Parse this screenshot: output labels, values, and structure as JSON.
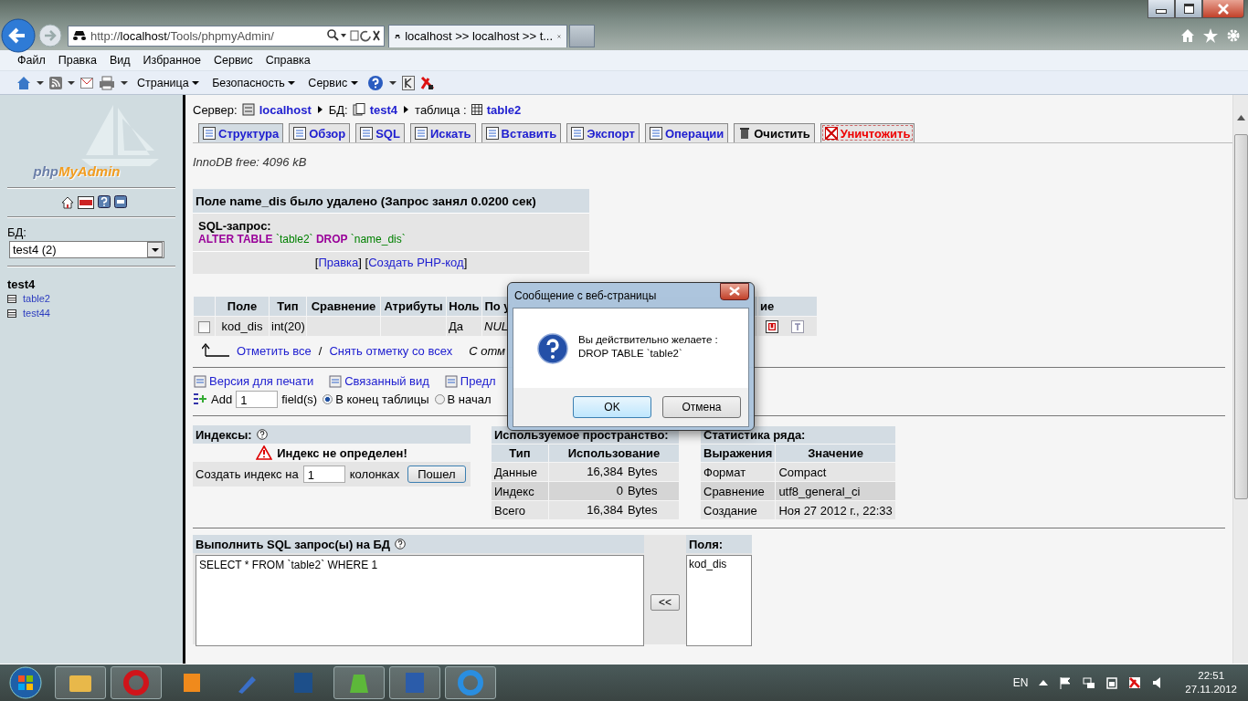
{
  "browser": {
    "address_prefix": "http://",
    "address_host": "localhost",
    "address_path": "/Tools/phpmyAdmin/",
    "tab_title": "localhost >> localhost >> t...",
    "menu": [
      "Файл",
      "Правка",
      "Вид",
      "Избранное",
      "Сервис",
      "Справка"
    ],
    "commands": [
      "Страница",
      "Безопасность",
      "Сервис"
    ]
  },
  "sidebar": {
    "logo_a": "php",
    "logo_b": "MyAdmin",
    "db_label": "БД:",
    "db_select": "test4 (2)",
    "db_name": "test4",
    "tables": [
      "table2",
      "test44"
    ]
  },
  "breadcrumb": {
    "server_label": "Сервер:",
    "server": "localhost",
    "db_label": "БД:",
    "db": "test4",
    "table_label": "таблица :",
    "table": "table2"
  },
  "tabs": [
    {
      "label": "Структура",
      "selected": true,
      "kind": "normal"
    },
    {
      "label": "Обзор",
      "selected": false,
      "kind": "normal"
    },
    {
      "label": "SQL",
      "selected": false,
      "kind": "normal"
    },
    {
      "label": "Искать",
      "selected": false,
      "kind": "normal"
    },
    {
      "label": "Вставить",
      "selected": false,
      "kind": "normal"
    },
    {
      "label": "Экспорт",
      "selected": false,
      "kind": "normal"
    },
    {
      "label": "Операции",
      "selected": false,
      "kind": "normal"
    },
    {
      "label": "Очистить",
      "selected": false,
      "kind": "plain"
    },
    {
      "label": "Уничтожить",
      "selected": false,
      "kind": "danger"
    }
  ],
  "innodb_free": "InnoDB free: 4096 kB",
  "message": {
    "title": "Поле name_dis было удалено (Запрос занял 0.0200 сек)",
    "sql_label": "SQL-запрос:",
    "sql": [
      {
        "text": "ALTER TABLE",
        "kind": "keyword"
      },
      {
        "text": "`table2`",
        "kind": "ident"
      },
      {
        "text": "DROP",
        "kind": "keyword"
      },
      {
        "text": "`name_dis`",
        "kind": "ident"
      }
    ],
    "links": [
      {
        "open": "[",
        "text": "Правка",
        "close": "]"
      },
      {
        "open": "[",
        "text": "Создать PHP-код",
        "close": "]"
      }
    ]
  },
  "structure": {
    "columns": [
      "Поле",
      "Тип",
      "Сравнение",
      "Атрибуты",
      "Ноль",
      "По у",
      "ие"
    ],
    "rows": [
      {
        "checked": false,
        "field": "kod_dis",
        "type": "int(20)",
        "null": "Да",
        "default": "NUL"
      }
    ]
  },
  "check_actions": {
    "check_all": "Отметить все",
    "separator": "/",
    "uncheck_all": "Снять отметку со всех",
    "with_selected": "С отм"
  },
  "links": [
    "Версия для печати",
    "Связанный вид",
    "Предл"
  ],
  "add_field": {
    "label": "Add",
    "value": "1",
    "unit": "field(s)",
    "options": [
      {
        "label": "В конец таблицы",
        "selected": true
      },
      {
        "label": "В начал",
        "selected": false
      }
    ]
  },
  "indexes": {
    "title": "Индексы:",
    "warning": "Индекс не определен!",
    "create_label": "Создать индекс на",
    "value": "1",
    "unit": "колонках",
    "button": "Пошел"
  },
  "space": {
    "title": "Используемое пространство:",
    "columns": [
      "Тип",
      "Использование"
    ],
    "rows": [
      [
        "Данные",
        "16,384",
        "Bytes"
      ],
      [
        "Индекс",
        "0",
        "Bytes"
      ],
      [
        "Всего",
        "16,384",
        "Bytes"
      ]
    ]
  },
  "row_stats": {
    "title": "Статистика ряда:",
    "columns": [
      "Выражения",
      "Значение"
    ],
    "rows": [
      [
        "Формат",
        "Compact"
      ],
      [
        "Сравнение",
        "utf8_general_ci"
      ],
      [
        "Создание",
        "Ноя 27 2012 г., 22:33"
      ]
    ]
  },
  "sql_box": {
    "title": "Выполнить SQL запрос(ы) на БД",
    "query": "SELECT * FROM `table2` WHERE 1",
    "insert_button": "<<",
    "fields_title": "Поля:",
    "fields": [
      "kod_dis"
    ]
  },
  "dialog": {
    "title": "Сообщение с веб-страницы",
    "lines": [
      "Вы действительно желаете  :",
      "DROP TABLE `table2`"
    ],
    "buttons": [
      {
        "label": "OK",
        "selected": true
      },
      {
        "label": "Отмена",
        "selected": false
      }
    ]
  },
  "taskbar": {
    "apps": [
      {
        "kind": "folder",
        "open": true
      },
      {
        "kind": "ring",
        "open": true
      },
      {
        "kind": "player",
        "open": false
      },
      {
        "kind": "tool",
        "open": false
      },
      {
        "kind": "square",
        "open": false
      },
      {
        "kind": "meter",
        "open": true
      },
      {
        "kind": "document",
        "open": true
      },
      {
        "kind": "globe",
        "open": true
      }
    ],
    "lang": "EN",
    "time": "22:51",
    "date": "27.11.2012"
  }
}
